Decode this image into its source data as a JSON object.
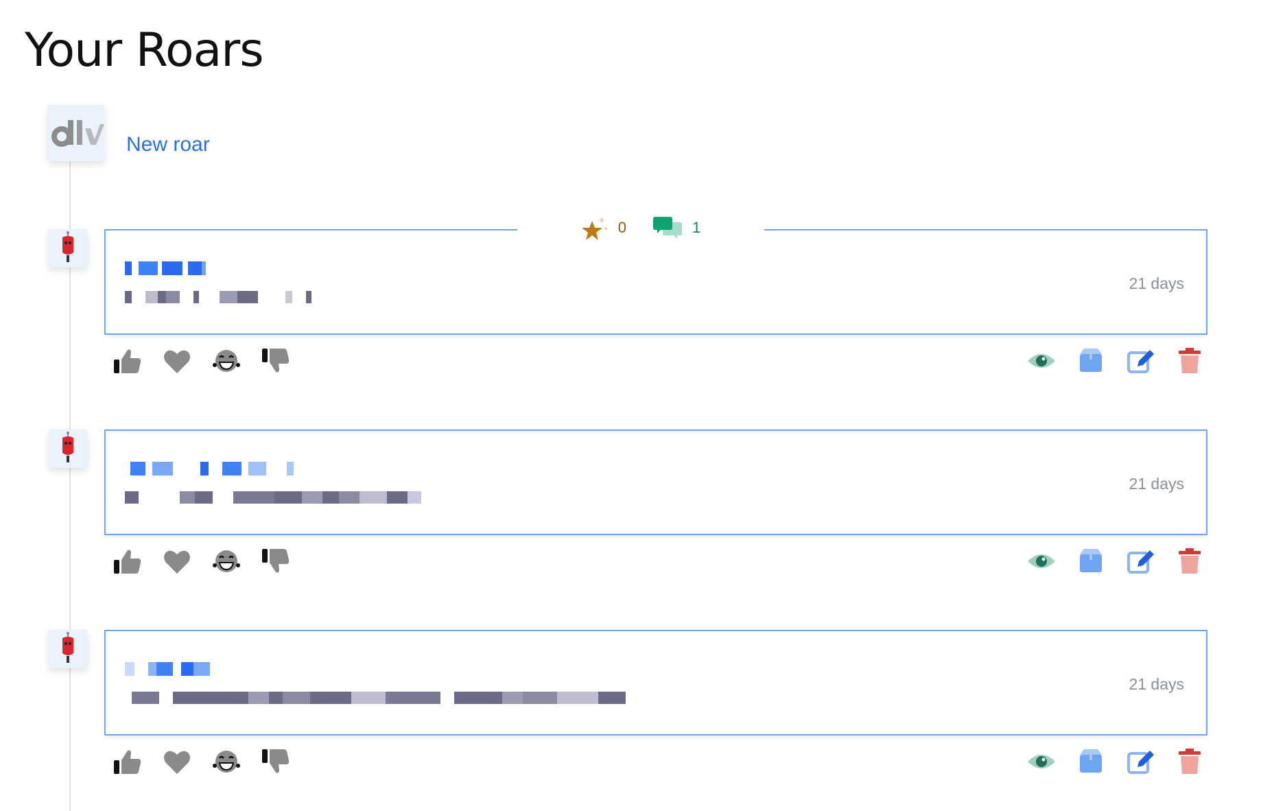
{
  "page": {
    "title": "Your Roars"
  },
  "composer": {
    "new_roar_label": "New roar",
    "avatar_icon": "dlv-logo-icon"
  },
  "colors": {
    "accent_blue": "#2b6fe6",
    "card_border": "#6fa4f1",
    "star_gold": "#c07a14",
    "comment_green": "#10a36f",
    "view_teal": "#1f6f5b",
    "delete_red": "#e8817c"
  },
  "roars": [
    {
      "stars": "0",
      "comments": "1",
      "date": "21 days",
      "show_stats": true
    },
    {
      "date": "21 days",
      "show_stats": false
    },
    {
      "date": "21 days",
      "show_stats": false
    }
  ],
  "reaction_icons": [
    "thumbs-up-icon",
    "heart-icon",
    "laughing-face-icon",
    "thumbs-down-icon"
  ],
  "action_icons": [
    "eye-icon",
    "archive-box-icon",
    "edit-icon",
    "trash-icon"
  ]
}
